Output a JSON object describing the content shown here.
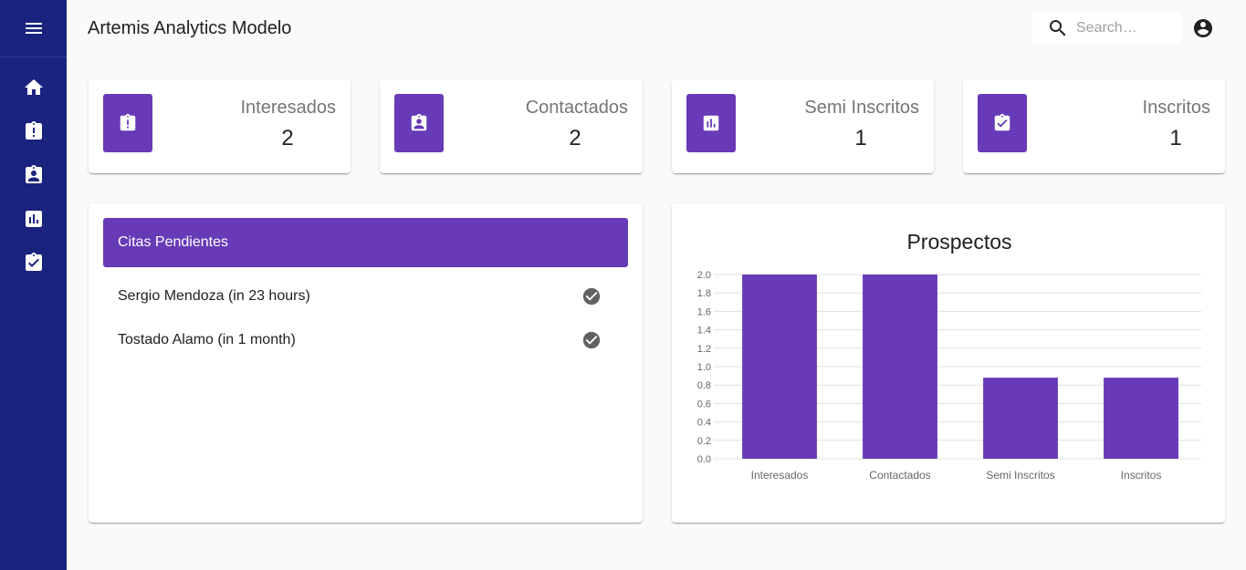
{
  "app": {
    "title": "Artemis Analytics Modelo"
  },
  "search": {
    "placeholder": "Search…"
  },
  "sidebar": {
    "menu_icon": "menu-icon",
    "items": [
      {
        "icon": "home-icon"
      },
      {
        "icon": "clipboard-alert-icon"
      },
      {
        "icon": "clipboard-account-icon"
      },
      {
        "icon": "bar-chart-icon"
      },
      {
        "icon": "clipboard-check-icon"
      }
    ]
  },
  "stats": [
    {
      "label": "Interesados",
      "value": "2",
      "icon": "clipboard-alert-icon"
    },
    {
      "label": "Contactados",
      "value": "2",
      "icon": "clipboard-account-icon"
    },
    {
      "label": "Semi Inscritos",
      "value": "1",
      "icon": "bar-chart-icon"
    },
    {
      "label": "Inscritos",
      "value": "1",
      "icon": "clipboard-check-icon"
    }
  ],
  "citas": {
    "title": "Citas Pendientes",
    "items": [
      {
        "text": "Sergio Mendoza (in 23 hours)"
      },
      {
        "text": "Tostado Alamo (in 1 month)"
      }
    ]
  },
  "colors": {
    "sidebar": "#1a237e",
    "accent": "#673ab7",
    "background": "#fafafa"
  },
  "chart_data": {
    "type": "bar",
    "title": "Prospectos",
    "categories": [
      "Interesados",
      "Contactados",
      "Semi Inscritos",
      "Inscritos"
    ],
    "values": [
      2,
      2,
      0.88,
      0.88
    ],
    "ylim": [
      0,
      2
    ],
    "yticks": [
      "0.0",
      "0.2",
      "0.4",
      "0.6",
      "0.8",
      "1.0",
      "1.2",
      "1.4",
      "1.6",
      "1.8",
      "2.0"
    ],
    "grid": true,
    "color": "#673ab7"
  }
}
